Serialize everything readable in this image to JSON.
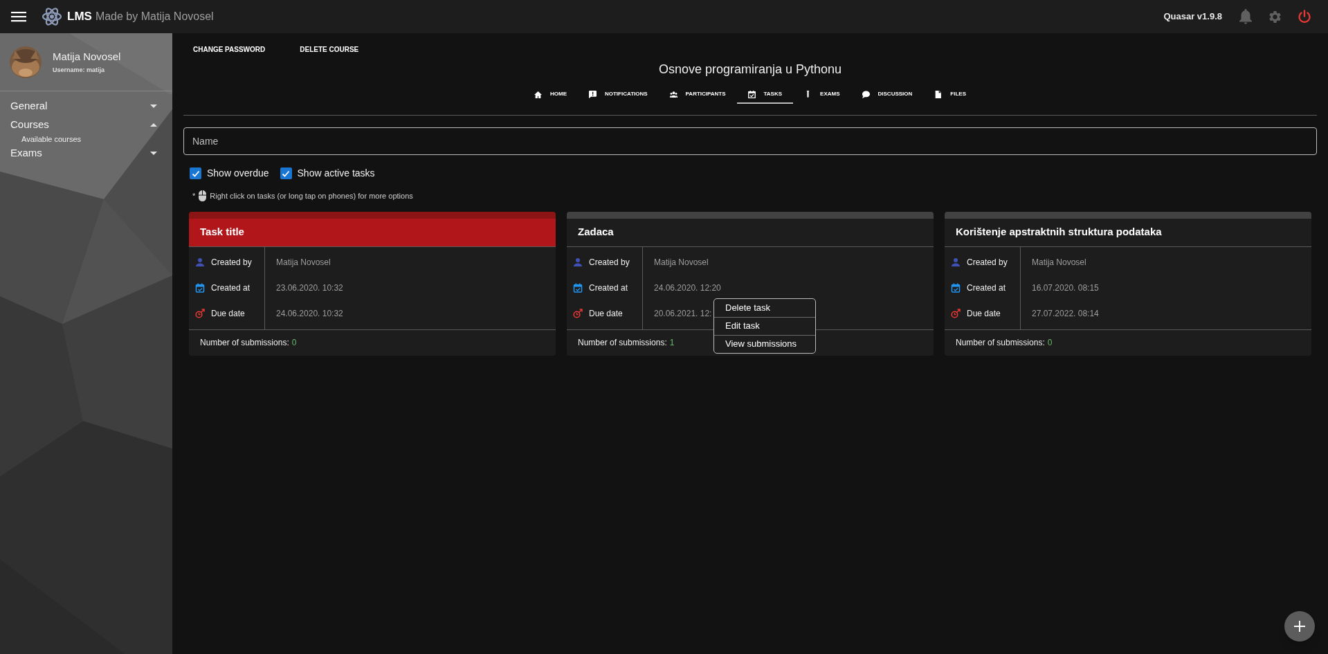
{
  "header": {
    "app_name": "LMS",
    "subtitle": "Made by Matija Novosel",
    "version": "Quasar v1.9.8"
  },
  "user": {
    "name": "Matija Novosel",
    "username_label": "Username:",
    "username": "matija"
  },
  "sidebar": {
    "items": [
      {
        "label": "General",
        "expanded": false
      },
      {
        "label": "Courses",
        "expanded": true,
        "children": [
          {
            "label": "Available courses"
          }
        ]
      },
      {
        "label": "Exams",
        "expanded": false
      }
    ]
  },
  "actions": [
    "CHANGE PASSWORD",
    "DELETE COURSE"
  ],
  "course_title": "Osnove programiranja u Pythonu",
  "tabs": [
    {
      "label": "HOME",
      "kind": "home",
      "selected": false
    },
    {
      "label": "NOTIFICATIONS",
      "kind": "notifications",
      "selected": false
    },
    {
      "label": "PARTICIPANTS",
      "kind": "participants",
      "selected": false
    },
    {
      "label": "TASKS",
      "kind": "tasks",
      "selected": true
    },
    {
      "label": "EXAMS",
      "kind": "exams",
      "selected": false
    },
    {
      "label": "DISCUSSION",
      "kind": "discussion",
      "selected": false
    },
    {
      "label": "FILES",
      "kind": "files",
      "selected": false
    }
  ],
  "search": {
    "placeholder": "Name"
  },
  "filters": [
    {
      "label": "Show overdue",
      "checked": true
    },
    {
      "label": "Show active tasks",
      "checked": true
    }
  ],
  "hint": {
    "prefix": "*",
    "text": "Right click on tasks (or long tap on phones) for more options"
  },
  "tasks": [
    {
      "title": "Task title",
      "overdue": true,
      "fields": [
        {
          "kind": "creator",
          "label": "Created by",
          "value": "Matija Novosel"
        },
        {
          "kind": "created",
          "label": "Created at",
          "value": "23.06.2020. 10:32"
        },
        {
          "kind": "due",
          "label": "Due date",
          "value": "24.06.2020. 10:32"
        }
      ],
      "submissions_label": "Number of submissions:",
      "submissions": "0"
    },
    {
      "title": "Zadaca",
      "overdue": false,
      "fields": [
        {
          "kind": "creator",
          "label": "Created by",
          "value": "Matija Novosel"
        },
        {
          "kind": "created",
          "label": "Created at",
          "value": "24.06.2020. 12:20"
        },
        {
          "kind": "due",
          "label": "Due date",
          "value": "20.06.2021. 12:"
        }
      ],
      "submissions_label": "Number of submissions:",
      "submissions": "1",
      "context_menu": [
        "Delete task",
        "Edit task",
        "View submissions"
      ]
    },
    {
      "title": "Korištenje apstraktnih struktura podataka",
      "overdue": false,
      "fields": [
        {
          "kind": "creator",
          "label": "Created by",
          "value": "Matija Novosel"
        },
        {
          "kind": "created",
          "label": "Created at",
          "value": "16.07.2020. 08:15"
        },
        {
          "kind": "due",
          "label": "Due date",
          "value": "27.07.2022. 08:14"
        }
      ],
      "submissions_label": "Number of submissions:",
      "submissions": "0"
    }
  ]
}
